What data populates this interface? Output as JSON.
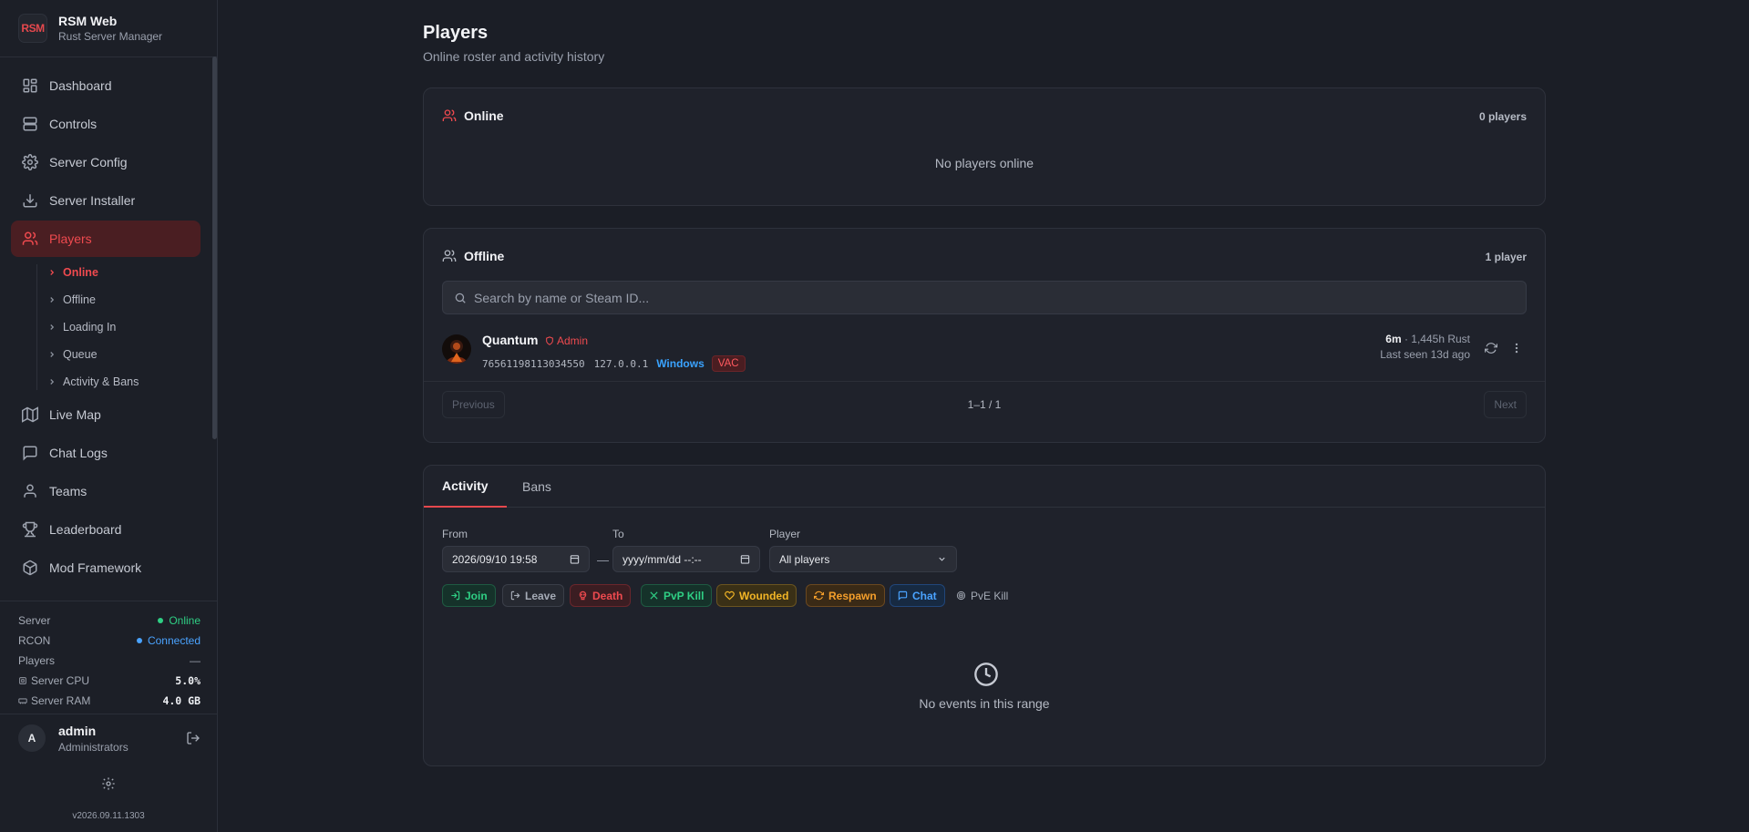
{
  "brand": {
    "logo": "RSM",
    "name": "RSM Web",
    "subtitle": "Rust Server Manager"
  },
  "nav": {
    "items": [
      {
        "label": "Dashboard",
        "icon": "dashboard-icon"
      },
      {
        "label": "Controls",
        "icon": "server-icon"
      },
      {
        "label": "Server Config",
        "icon": "gear-icon"
      },
      {
        "label": "Server Installer",
        "icon": "download-icon"
      },
      {
        "label": "Players",
        "icon": "users-icon",
        "active": true
      },
      {
        "label": "Live Map",
        "icon": "map-icon"
      },
      {
        "label": "Chat Logs",
        "icon": "chat-icon"
      },
      {
        "label": "Teams",
        "icon": "team-icon"
      },
      {
        "label": "Leaderboard",
        "icon": "trophy-icon"
      },
      {
        "label": "Mod Framework",
        "icon": "box-icon"
      }
    ],
    "sub_items": [
      {
        "label": "Online",
        "active": true
      },
      {
        "label": "Offline"
      },
      {
        "label": "Loading In"
      },
      {
        "label": "Queue"
      },
      {
        "label": "Activity & Bans"
      }
    ]
  },
  "status": {
    "server_label": "Server",
    "server_value": "Online",
    "rcon_label": "RCON",
    "rcon_value": "Connected",
    "players_label": "Players",
    "players_value": "—",
    "cpu_label": "Server CPU",
    "cpu_value": "5.0%",
    "ram_label": "Server RAM",
    "ram_value": "4.0 GB"
  },
  "user": {
    "initial": "A",
    "name": "admin",
    "role": "Administrators"
  },
  "version": "v2026.09.11.1303",
  "page": {
    "title": "Players",
    "subtitle": "Online roster and activity history"
  },
  "online": {
    "title": "Online",
    "count": "0 players",
    "empty": "No players online"
  },
  "offline": {
    "title": "Offline",
    "count": "1 player",
    "search_placeholder": "Search by name or Steam ID...",
    "players": [
      {
        "name": "Quantum",
        "badge": "Admin",
        "steam_id": "76561198113034550",
        "ip": "127.0.0.1",
        "os": "Windows",
        "flag": "VAC",
        "session": "6m",
        "total": "· 1,445h Rust",
        "last_seen": "Last seen 13d ago"
      }
    ],
    "pager": {
      "prev": "Previous",
      "info": "1–1 / 1",
      "next": "Next"
    }
  },
  "activity": {
    "tabs": [
      "Activity",
      "Bans"
    ],
    "from_label": "From",
    "from_value": "2026/09/10 19:58",
    "to_label": "To",
    "to_value": "yyyy/mm/dd --:--",
    "separator": "—",
    "player_label": "Player",
    "player_value": "All players",
    "filters": [
      {
        "label": "Join",
        "icon": "login-icon",
        "color": "#2fcf84"
      },
      {
        "label": "Leave",
        "icon": "logout-icon",
        "color": "#a5abb6"
      },
      {
        "label": "Death",
        "icon": "skull-icon",
        "color": "#ef4a4f"
      },
      {
        "label": "PvP Kill",
        "icon": "swords-icon",
        "color": "#2fcf84"
      },
      {
        "label": "Wounded",
        "icon": "heart-icon",
        "color": "#f2b526"
      },
      {
        "label": "Respawn",
        "icon": "refresh-icon",
        "color": "#f59f2b"
      },
      {
        "label": "Chat",
        "icon": "chat-icon",
        "color": "#4aa3ff"
      },
      {
        "label": "PvE Kill",
        "icon": "target-icon",
        "color": "#a5abb6"
      }
    ],
    "empty": "No events in this range"
  }
}
